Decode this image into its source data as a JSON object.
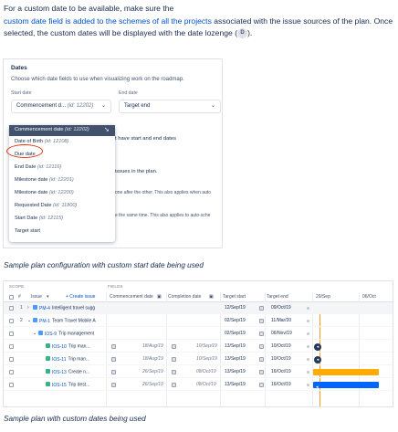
{
  "intro": {
    "text_before": "For a custom date to be available, make sure the",
    "link_text": "custom date field is added to the schemes of all the projects",
    "text_after": "associated with the issue sources of the plan. Once selected, the custom dates will be displayed with the date lozenge (",
    "lozenge_letter": "D",
    "text_end": ")."
  },
  "shot1": {
    "title": "Dates",
    "description": "Choose which date fields to use when visualizing work on the roadmap.",
    "start_label": "Start date",
    "start_value": "Commencement d...",
    "start_id": "(id: 12202)",
    "end_label": "End date",
    "end_value": "Target end",
    "bg_texts": [
      "t have start and end dates",
      "issues in the plan.",
      "one after the other. This also applies when auto",
      "e the same time. This also applies to auto-sche"
    ],
    "dropdown": [
      {
        "name": "Commencement date",
        "id": "(id: 12202)",
        "selected": true
      },
      {
        "name": "Date of Birth",
        "id": "(id: 12108)"
      },
      {
        "name": "Due date",
        "id": ""
      },
      {
        "name": "End Date",
        "id": "(id: 12116)"
      },
      {
        "name": "Milestone date",
        "id": "(id: 12201)"
      },
      {
        "name": "Milestone date",
        "id": "(id: 12200)"
      },
      {
        "name": "Requested Date",
        "id": "(id: 11800)"
      },
      {
        "name": "Start Date",
        "id": "(id: 12115)"
      },
      {
        "name": "Target start",
        "id": ""
      }
    ]
  },
  "caption1": "Sample plan configuration with custom start date being used",
  "shot2": {
    "scope_label": "SCOPE",
    "fields_label": "FIELDS",
    "headers": {
      "hash": "#",
      "issue": "Issue",
      "create": "+ Create issue",
      "commencement": "Commencement date",
      "completion": "Completion date",
      "target_start": "Target start",
      "target_end": "Target end",
      "week1": "29/Sep",
      "week2": "06/Oct"
    },
    "rows": [
      {
        "num": "1",
        "key": "PM-4",
        "summary": "Intelligent travel sugg",
        "icon": "blue",
        "indent": 0,
        "target_start": "12/Sep/19",
        "target_end": "09/Oct/19"
      },
      {
        "num": "2",
        "key": "PM-1",
        "summary": "Team Travel Mobile A",
        "icon": "blue",
        "indent": 0,
        "target_start": "02/Sep/19",
        "target_end": "11/Mar/20"
      },
      {
        "num": "",
        "key": "IOS-9",
        "summary": "Trip management",
        "icon": "blue",
        "indent": 1,
        "target_start": "02/Sep/19",
        "target_end": "06/Nov/19"
      },
      {
        "num": "",
        "key": "IOS-10",
        "summary": "Trip man...",
        "icon": "green",
        "indent": 2,
        "commencement": "18/Aug/19",
        "completion": "10/Sep/19",
        "target_start": "13/Sep/19",
        "target_end": "10/Oct/19"
      },
      {
        "num": "",
        "key": "IOS-11",
        "summary": "Trip man...",
        "icon": "green",
        "indent": 2,
        "commencement": "18/Aug/19",
        "completion": "10/Sep/19",
        "target_start": "13/Sep/19",
        "target_end": "10/Oct/19"
      },
      {
        "num": "",
        "key": "IOS-13",
        "summary": "Create n...",
        "icon": "green",
        "indent": 2,
        "commencement": "26/Sep/19",
        "completion": "08/Oct/19",
        "target_start": "13/Sep/19",
        "target_end": "16/Oct/19"
      },
      {
        "num": "",
        "key": "IOS-15",
        "summary": "Trip dest...",
        "icon": "green",
        "indent": 2,
        "commencement": "26/Sep/19",
        "completion": "08/Oct/19",
        "target_start": "13/Sep/19",
        "target_end": "16/Oct/19"
      }
    ],
    "colors": {
      "bar_orange": "#ffab00",
      "bar_blue": "#0065ff",
      "today": "#ff991f"
    }
  },
  "caption2": "Sample plan with custom dates being used"
}
